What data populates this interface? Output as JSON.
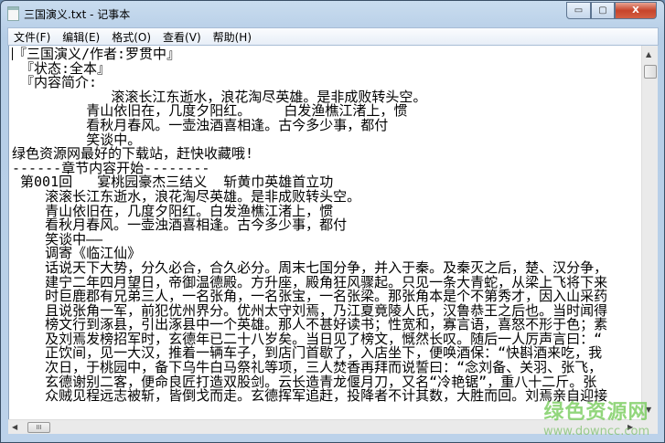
{
  "window": {
    "title": "三国演义.txt - 记事本",
    "min": "▭",
    "max": "▢",
    "close": "X"
  },
  "menu": [
    "文件(F)",
    "编辑(E)",
    "格式(O)",
    "查看(V)",
    "帮助(H)"
  ],
  "lines": [
    "『三国演义/作者:罗贯中』",
    " 『状态:全本』",
    " 『内容简介:",
    "            滚滚长江东逝水，浪花淘尽英雄。是非成败转头空。",
    "         青山依旧在，几度夕阳红。    白发渔樵江渚上，惯",
    "         看秋月春风。一壶浊酒喜相逢。古今多少事，都付",
    "         笑谈中。",
    "绿色资源网最好的下载站，赶快收藏哦!",
    "------章节内容开始--------",
    " 第001回   宴桃园豪杰三结义  斩黄巾英雄首立功",
    "    滚滚长江东逝水，浪花淘尽英雄。是非成败转头空。",
    "    青山依旧在，几度夕阳红。白发渔樵江渚上，惯",
    "    看秋月春风。一壶浊酒喜相逢。古今多少事，都付",
    "    笑谈中——",
    "    调寄《临江仙》",
    "    话说天下大势，分久必合，合久必分。周末七国分争，并入于秦。及秦灭之后，楚、汉分争，",
    "    建宁二年四月望日，帝御温德殿。方升座，殿角狂风骤起。只见一条大青蛇，从梁上飞将下来",
    "    时巨鹿郡有兄弟三人，一名张角，一名张宝，一名张梁。那张角本是个不第秀才，因入山采药",
    "    且说张角一军，前犯优州界分。优州太守刘焉，乃江夏竟陵人氏，汉鲁恭王之后也。当时闻得",
    "    榜文行到涿县，引出涿县中一个英雄。那人不甚好读书；性宽和，寡言语，喜怒不形于色；素",
    "    及刘焉发榜招军时，玄德年已二十八岁矣。当日见了榜文，慨然长叹。随后一人厉声言曰：“",
    "    正饮间，见一大汉，推着一辆车子，到店门首歇了，入店坐下，便唤酒保：“快斟酒来吃，我",
    "    次日，于桃园中，备下乌牛白马祭礼等项，三人焚香再拜而说誓曰：“念刘备、关羽、张飞，",
    "    玄德谢别二客，便命良匠打造双股剑。云长造青龙偃月刀，又名“冷艳锯”，重八十二斤。张",
    "    众贼见程远志被斩，皆倒戈而走。玄德挥军追赶，投降者不计其数，大胜而回。刘焉亲自迎接"
  ],
  "scroll": {
    "up": "▲",
    "down": "▼",
    "left": "◀",
    "right": "▶",
    "thumb_grip": "III"
  },
  "watermark": {
    "name": "绿色资源网",
    "url": "www.downcc.com"
  }
}
